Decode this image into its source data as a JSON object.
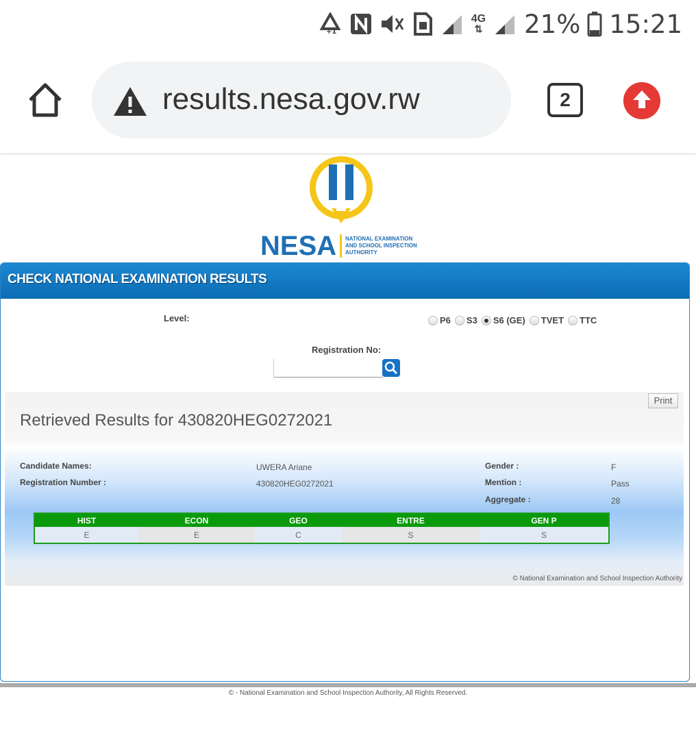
{
  "status_bar": {
    "battery": "21%",
    "time": "15:21",
    "network_label": "4G",
    "icons": [
      "recycle-icon",
      "nfc-icon",
      "mute-icon",
      "sim-icon",
      "signal-icon",
      "network-4g-icon",
      "signal-icon",
      "battery-icon"
    ]
  },
  "browser": {
    "url": "results.nesa.gov.rw",
    "tab_count": "2",
    "icons": [
      "home-icon",
      "warning-icon",
      "tabs-icon",
      "update-icon"
    ]
  },
  "logo": {
    "brand": "NESA",
    "line1": "NATIONAL EXAMINATION",
    "line2": "AND SCHOOL INSPECTION",
    "line3": "AUTHORITY"
  },
  "panel": {
    "title": "CHECK NATIONAL EXAMINATION RESULTS",
    "level_label": "Level:",
    "levels": [
      {
        "label": "P6",
        "selected": false
      },
      {
        "label": "S3",
        "selected": false
      },
      {
        "label": "S6 (GE)",
        "selected": true
      },
      {
        "label": "TVET",
        "selected": false
      },
      {
        "label": "TTC",
        "selected": false
      }
    ],
    "reg_label": "Registration No:",
    "reg_value": ""
  },
  "results": {
    "print_label": "Print",
    "title": "Retrieved Results for 430820HEG0272021",
    "candidate_names_label": "Candidate Names:",
    "candidate_names": "UWERA Ariane",
    "reg_number_label": "Registration Number :",
    "reg_number": "430820HEG0272021",
    "gender_label": "Gender :",
    "gender": "F",
    "mention_label": "Mention :",
    "mention": "Pass",
    "aggregate_label": "Aggregate :",
    "aggregate": "28",
    "subjects": [
      "HIST",
      "ECON",
      "GEO",
      "ENTRE",
      "GEN P"
    ],
    "grades": [
      "E",
      "E",
      "C",
      "S",
      "S"
    ],
    "copyright": "© National Examination and School Inspection Authority"
  },
  "footer": {
    "text": "© - National Examination and School Inspection Authority, All Rights Reserved."
  },
  "colors": {
    "header_blue": "#0b6cb3",
    "table_green": "#0a9a0a",
    "update_red": "#e53935"
  }
}
